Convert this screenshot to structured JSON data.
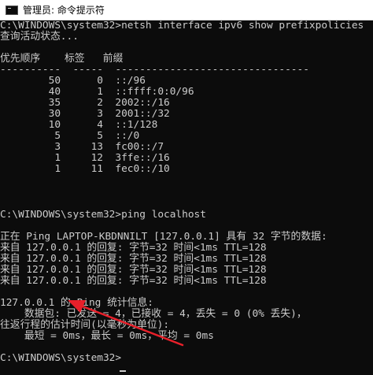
{
  "window": {
    "title": "管理员: 命令提示符",
    "icon": "cmd-icon"
  },
  "console": {
    "lines": [
      "C:\\WINDOWS\\system32>netsh interface ipv6 show prefixpolicies",
      "查询活动状态...",
      "",
      "优先顺序    标签   前缀",
      "----------  -----  --------------------------------",
      "        50      0  ::/96",
      "        40      1  ::ffff:0:0/96",
      "        35      2  2002::/16",
      "        30      3  2001::/32",
      "        10      4  ::1/128",
      "         5      5  ::/0",
      "         3     13  fc00::/7",
      "         1     12  3ffe::/16",
      "         1     11  fec0::/10",
      "",
      "",
      "C:\\WINDOWS\\system32>ping localhost",
      "",
      "正在 Ping LAPTOP-KBDNNILT [127.0.0.1] 具有 32 字节的数据:",
      "来自 127.0.0.1 的回复: 字节=32 时间<1ms TTL=128",
      "来自 127.0.0.1 的回复: 字节=32 时间<1ms TTL=128",
      "来自 127.0.0.1 的回复: 字节=32 时间<1ms TTL=128",
      "来自 127.0.0.1 的回复: 字节=32 时间<1ms TTL=128",
      "",
      "127.0.0.1 的 Ping 统计信息:",
      "    数据包: 已发送 = 4，已接收 = 4，丢失 = 0 (0% 丢失)，",
      "往返行程的估计时间(以毫秒为单位):",
      "    最短 = 0ms，最长 = 0ms，平均 = 0ms",
      "",
      "C:\\WINDOWS\\system32>"
    ]
  },
  "colors": {
    "background": "#0c0c0c",
    "text": "#cccccc",
    "titlebar": "#ffffff",
    "arrow": "#e8202a"
  }
}
